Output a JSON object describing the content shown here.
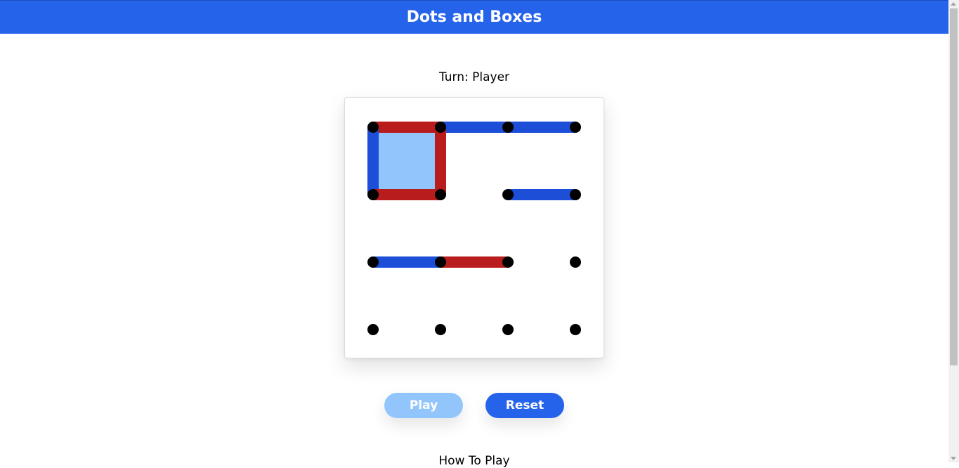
{
  "header": {
    "title": "Dots and Boxes"
  },
  "status": {
    "turn_text": "Turn: Player"
  },
  "board": {
    "rows": 4,
    "cols": 4,
    "colors": {
      "player": "#1d4ed8",
      "computer": "#b91c1c",
      "player_box": "#93c5fd",
      "dot": "#000000"
    },
    "boxes": [
      {
        "row": 0,
        "col": 0,
        "owner": "player"
      }
    ],
    "lines": [
      {
        "orientation": "h",
        "row": 0,
        "col": 0,
        "owner": "computer"
      },
      {
        "orientation": "h",
        "row": 0,
        "col": 1,
        "owner": "player"
      },
      {
        "orientation": "h",
        "row": 0,
        "col": 2,
        "owner": "player"
      },
      {
        "orientation": "v",
        "row": 0,
        "col": 0,
        "owner": "player"
      },
      {
        "orientation": "v",
        "row": 0,
        "col": 1,
        "owner": "computer"
      },
      {
        "orientation": "h",
        "row": 1,
        "col": 0,
        "owner": "computer"
      },
      {
        "orientation": "h",
        "row": 1,
        "col": 2,
        "owner": "player"
      },
      {
        "orientation": "h",
        "row": 2,
        "col": 0,
        "owner": "player"
      },
      {
        "orientation": "h",
        "row": 2,
        "col": 1,
        "owner": "computer"
      }
    ]
  },
  "controls": {
    "play_label": "Play",
    "reset_label": "Reset"
  },
  "footer": {
    "how_to_play": "How To Play"
  }
}
